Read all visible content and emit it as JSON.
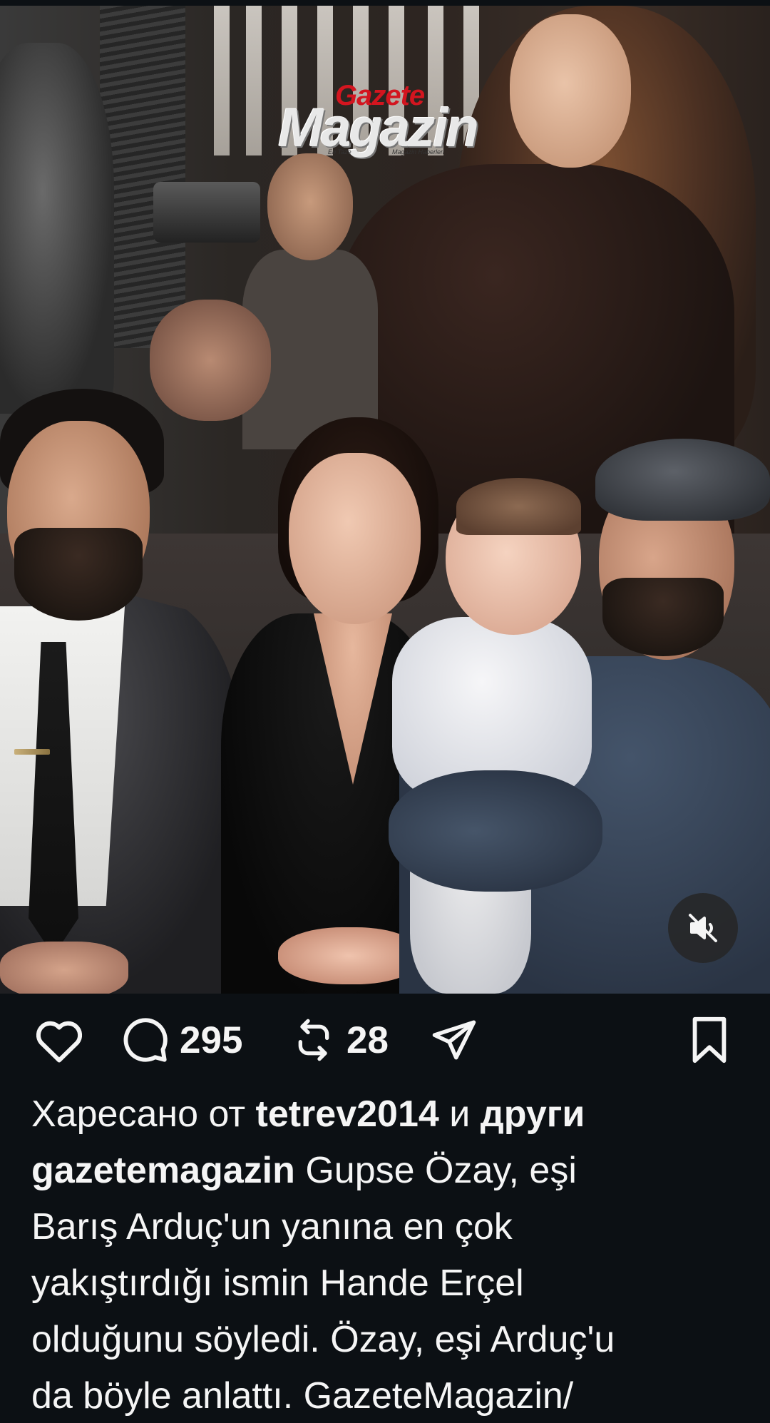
{
  "post": {
    "logo": {
      "top": "Gazete",
      "main": "Magazin",
      "sub_left": "En Taze",
      "sub_right": "Magazin Haberleri"
    },
    "mute_icon": "speaker-muted-icon"
  },
  "actions": {
    "like_icon": "heart-icon",
    "comment_icon": "comment-icon",
    "comment_count": "295",
    "repost_icon": "repost-icon",
    "repost_count": "28",
    "share_icon": "send-icon",
    "save_icon": "bookmark-icon"
  },
  "likes": {
    "prefix": "Харесано от",
    "user": "tetrev2014",
    "joiner": "и",
    "others": "други"
  },
  "caption": {
    "author": "gazetemagazin",
    "first_line": "Gupse Özay, eşi",
    "lines": [
      "Barış Arduç'un yanına en çok",
      "yakıştırdığı ismin Hande Erçel",
      "olduğunu söyledi. Özay, eşi Arduç'u",
      "da böyle anlattı. GazeteMagazin/"
    ]
  },
  "colors": {
    "background": "#0c1014",
    "text": "#f5f5f5",
    "logo_red": "#d3151f"
  }
}
